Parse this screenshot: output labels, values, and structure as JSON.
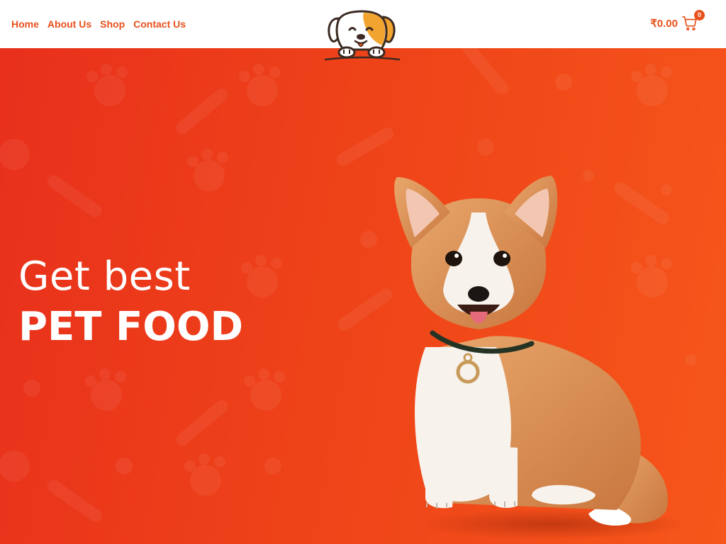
{
  "nav": {
    "items": [
      {
        "label": "Home"
      },
      {
        "label": "About Us"
      },
      {
        "label": "Shop"
      },
      {
        "label": "Contact Us"
      }
    ]
  },
  "logo": {
    "icon": "dog-logo-icon"
  },
  "cart": {
    "total": "₹0.00",
    "count": "0",
    "icon": "shopping-cart-icon"
  },
  "hero": {
    "line1": "Get best",
    "line2": "PET FOOD",
    "image": "corgi-puppy-image"
  },
  "colors": {
    "accent": "#e8501c",
    "hero_start": "#e8301c",
    "hero_end": "#f6561a",
    "text_light": "#ffffff"
  }
}
